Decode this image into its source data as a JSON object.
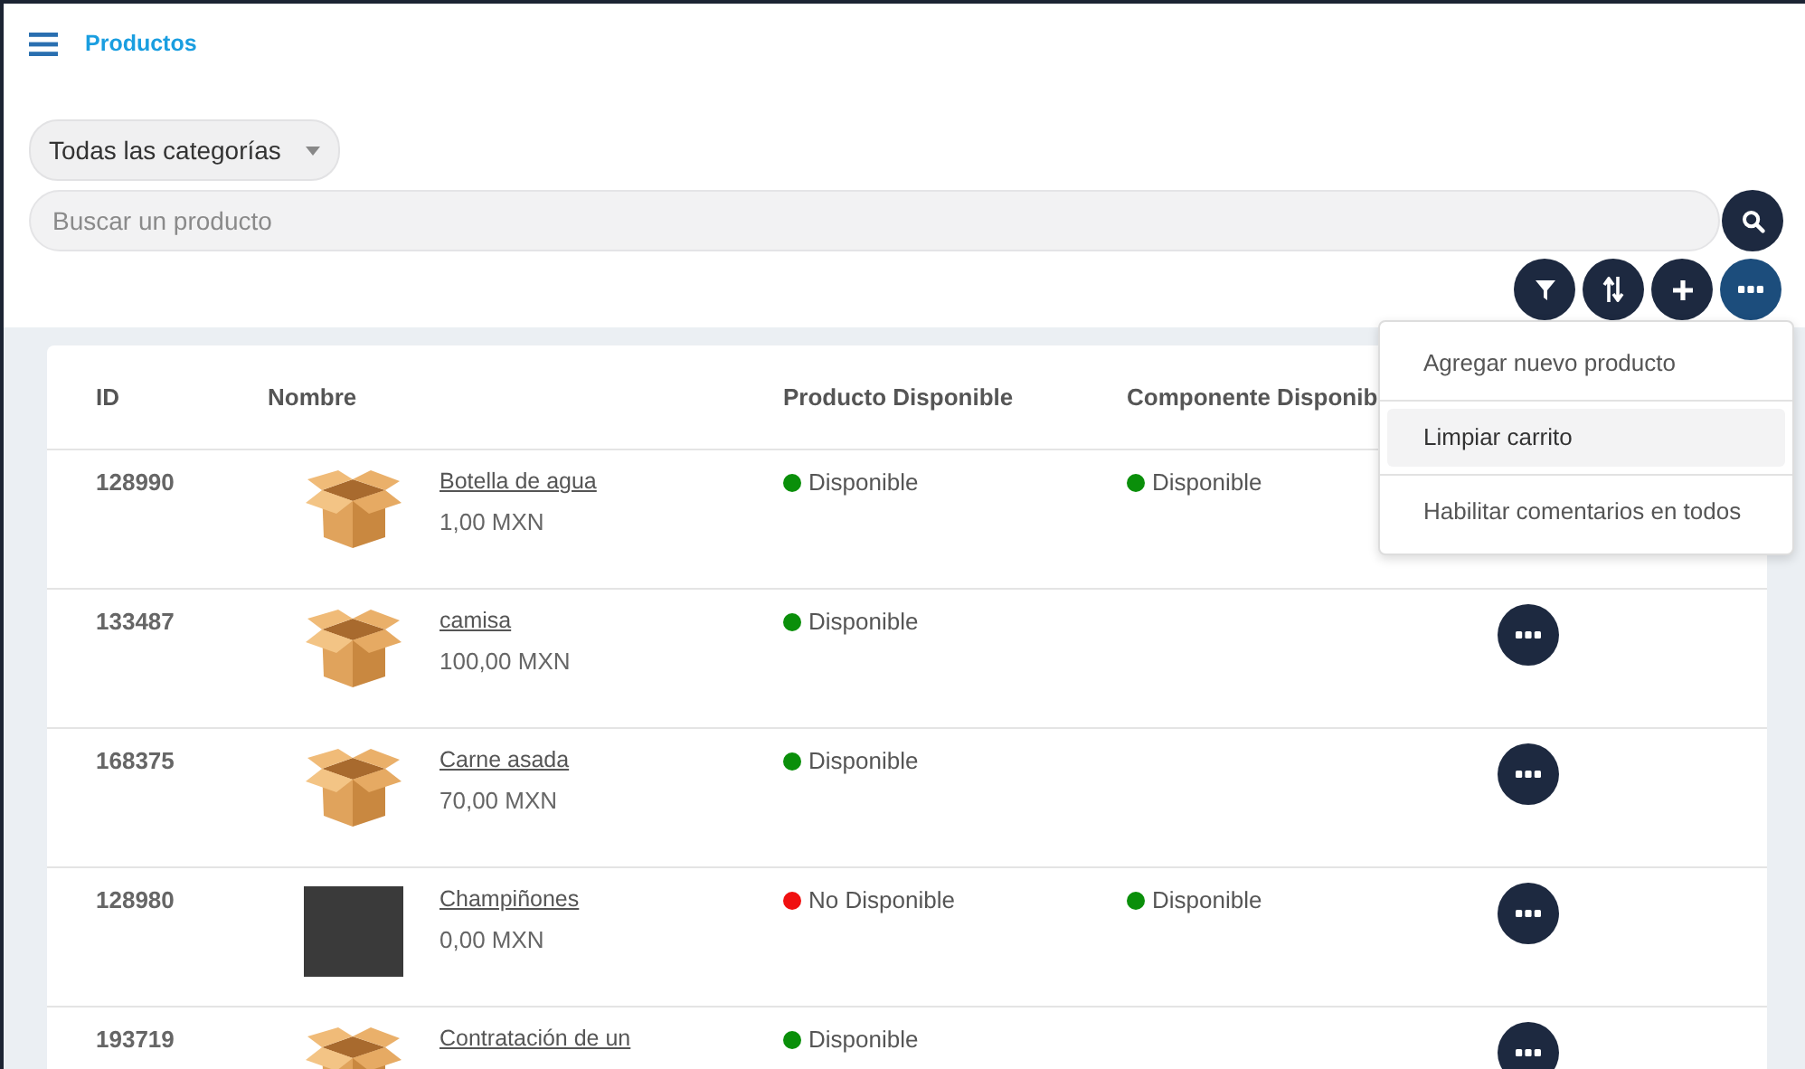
{
  "header": {
    "title": "Productos"
  },
  "category_select": {
    "value": "Todas las categorías"
  },
  "search": {
    "placeholder": "Buscar un producto"
  },
  "toolbar": [
    {
      "kind": "filter",
      "selected": false
    },
    {
      "kind": "sort",
      "selected": false
    },
    {
      "kind": "add",
      "selected": false
    },
    {
      "kind": "more",
      "selected": true
    }
  ],
  "menu": {
    "items": [
      {
        "label": "Agregar nuevo producto",
        "selected": false
      },
      {
        "label": "Limpiar carrito",
        "selected": true
      },
      {
        "label": "Habilitar comentarios en todos",
        "selected": false
      }
    ]
  },
  "table": {
    "columns": [
      "ID",
      "Nombre",
      "Producto Disponible",
      "Componente Disponib"
    ],
    "rows": [
      {
        "id": "128990",
        "kind": "box",
        "name": "Botella de agua",
        "price": "1,00 MXN",
        "product_status": {
          "text": "Disponible",
          "color": "#0a8f0a"
        },
        "component_status": {
          "text": "Disponible",
          "color": "#0a8f0a"
        }
      },
      {
        "id": "133487",
        "kind": "box",
        "name": "camisa",
        "price": "100,00 MXN",
        "product_status": {
          "text": "Disponible",
          "color": "#0a8f0a"
        }
      },
      {
        "id": "168375",
        "kind": "box",
        "name": "Carne asada",
        "price": "70,00 MXN",
        "product_status": {
          "text": "Disponible",
          "color": "#0a8f0a"
        }
      },
      {
        "id": "128980",
        "kind": "photo",
        "name": "Champiñones",
        "price": "0,00 MXN",
        "product_status": {
          "text": "No Disponible",
          "color": "#f01010"
        },
        "component_status": {
          "text": "Disponible",
          "color": "#0a8f0a"
        }
      },
      {
        "id": "193719",
        "kind": "box",
        "name": "Contratación de un",
        "product_status": {
          "text": "Disponible",
          "color": "#0a8f0a"
        }
      }
    ]
  }
}
